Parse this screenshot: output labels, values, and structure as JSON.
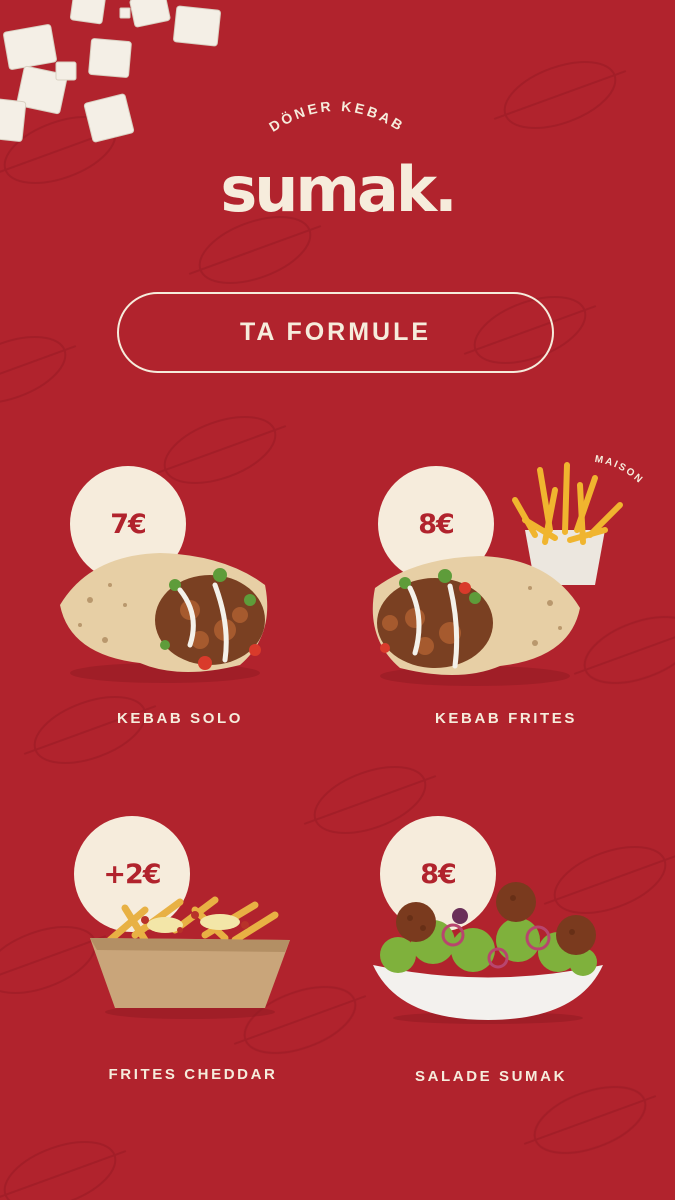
{
  "brand": {
    "tagline": "DÖNER KEBAB",
    "name": "sumak."
  },
  "header": {
    "formula_button": "TA FORMULE"
  },
  "badge": {
    "text": "MAISON"
  },
  "menu": [
    {
      "price": "7€",
      "label": "KEBAB SOLO"
    },
    {
      "price": "8€",
      "label": "KEBAB FRITES"
    },
    {
      "price": "+2€",
      "label": "FRITES CHEDDAR"
    },
    {
      "price": "8€",
      "label": "SALADE SUMAK"
    }
  ],
  "colors": {
    "background": "#b1232d",
    "cream": "#f6ecdc",
    "accent_text": "#b1232d"
  }
}
